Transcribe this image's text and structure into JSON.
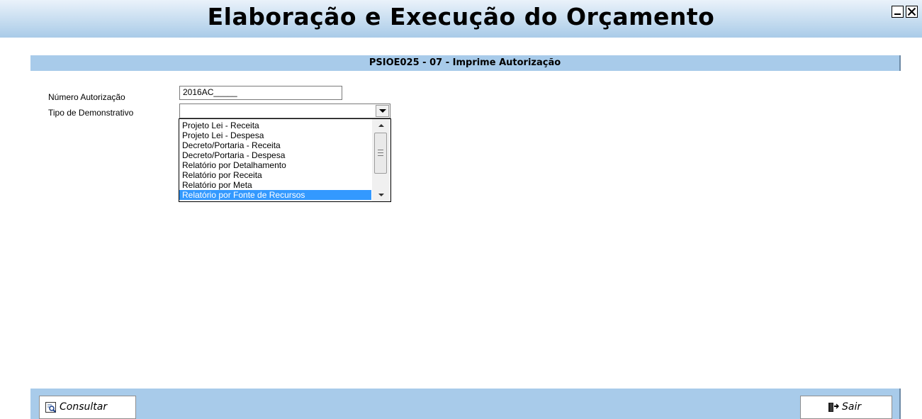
{
  "window": {
    "title": "Elaboração e Execução do Orçamento",
    "minimize_icon": "minimize-icon",
    "close_icon": "close-icon"
  },
  "screen": {
    "title": "PSIOE025 - 07 - Imprime Autorização"
  },
  "form": {
    "numero_label": "Número Autorização",
    "numero_value": "2016AC_____",
    "tipo_label": "Tipo de Demonstrativo",
    "tipo_value": ""
  },
  "dropdown": {
    "options": [
      "Projeto Lei - Receita",
      "Projeto Lei - Despesa",
      "Decreto/Portaria - Receita",
      "Decreto/Portaria - Despesa",
      "Relatório por Detalhamento",
      "Relatório por Receita",
      "Relatório por Meta",
      "Relatório por Fonte de Recursos"
    ],
    "highlighted": "Relatório por Fonte de Recursos"
  },
  "footer": {
    "consultar_label": "Consultar",
    "consultar_icon": "report-search-icon",
    "sair_label": "Sair",
    "sair_icon": "exit-door-icon"
  },
  "colors": {
    "band": "#a8cbea",
    "highlight": "#3399ff"
  }
}
